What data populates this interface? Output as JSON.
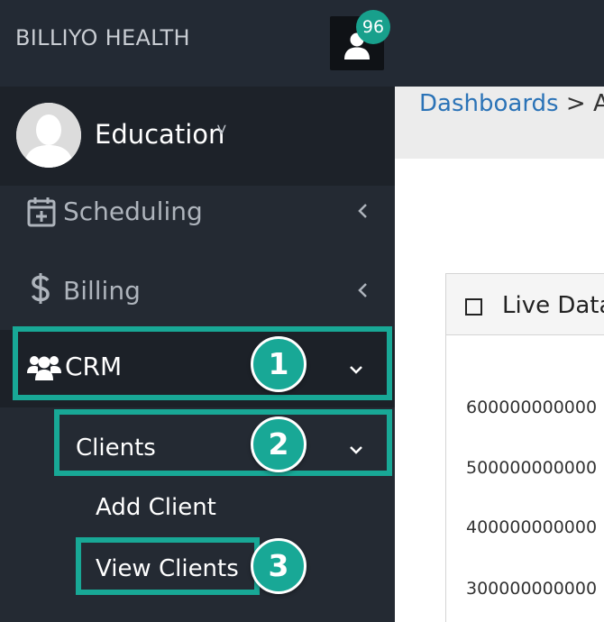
{
  "topbar": {
    "brand": "BILLIYO HEALTH",
    "notification_count": "96",
    "user_icon": "user-icon"
  },
  "profile": {
    "name": "Education",
    "caret": "˅"
  },
  "sidebar": {
    "items": [
      {
        "label": "Scheduling",
        "icon": "calendar-plus-icon",
        "chevron": "left"
      },
      {
        "label": "Billing",
        "icon": "dollar-icon",
        "chevron": "left"
      },
      {
        "label": "CRM",
        "icon": "users-icon",
        "chevron": "down"
      }
    ],
    "crm_submenu": {
      "label": "Clients",
      "chevron": "down",
      "children": [
        "Add Client",
        "View Clients"
      ]
    }
  },
  "annotations": {
    "steps": [
      "1",
      "2",
      "3"
    ],
    "color": "#18a896"
  },
  "breadcrumb": {
    "link": "Dashboards",
    "separator": ">",
    "current": "Ad"
  },
  "panel": {
    "title": "Live Data",
    "y_ticks": [
      "600000000000",
      "500000000000",
      "400000000000",
      "300000000000"
    ]
  },
  "colors": {
    "topbar": "#232a34",
    "sidebar": "#242a33",
    "accent": "#18a896",
    "link": "#2b73b7"
  }
}
